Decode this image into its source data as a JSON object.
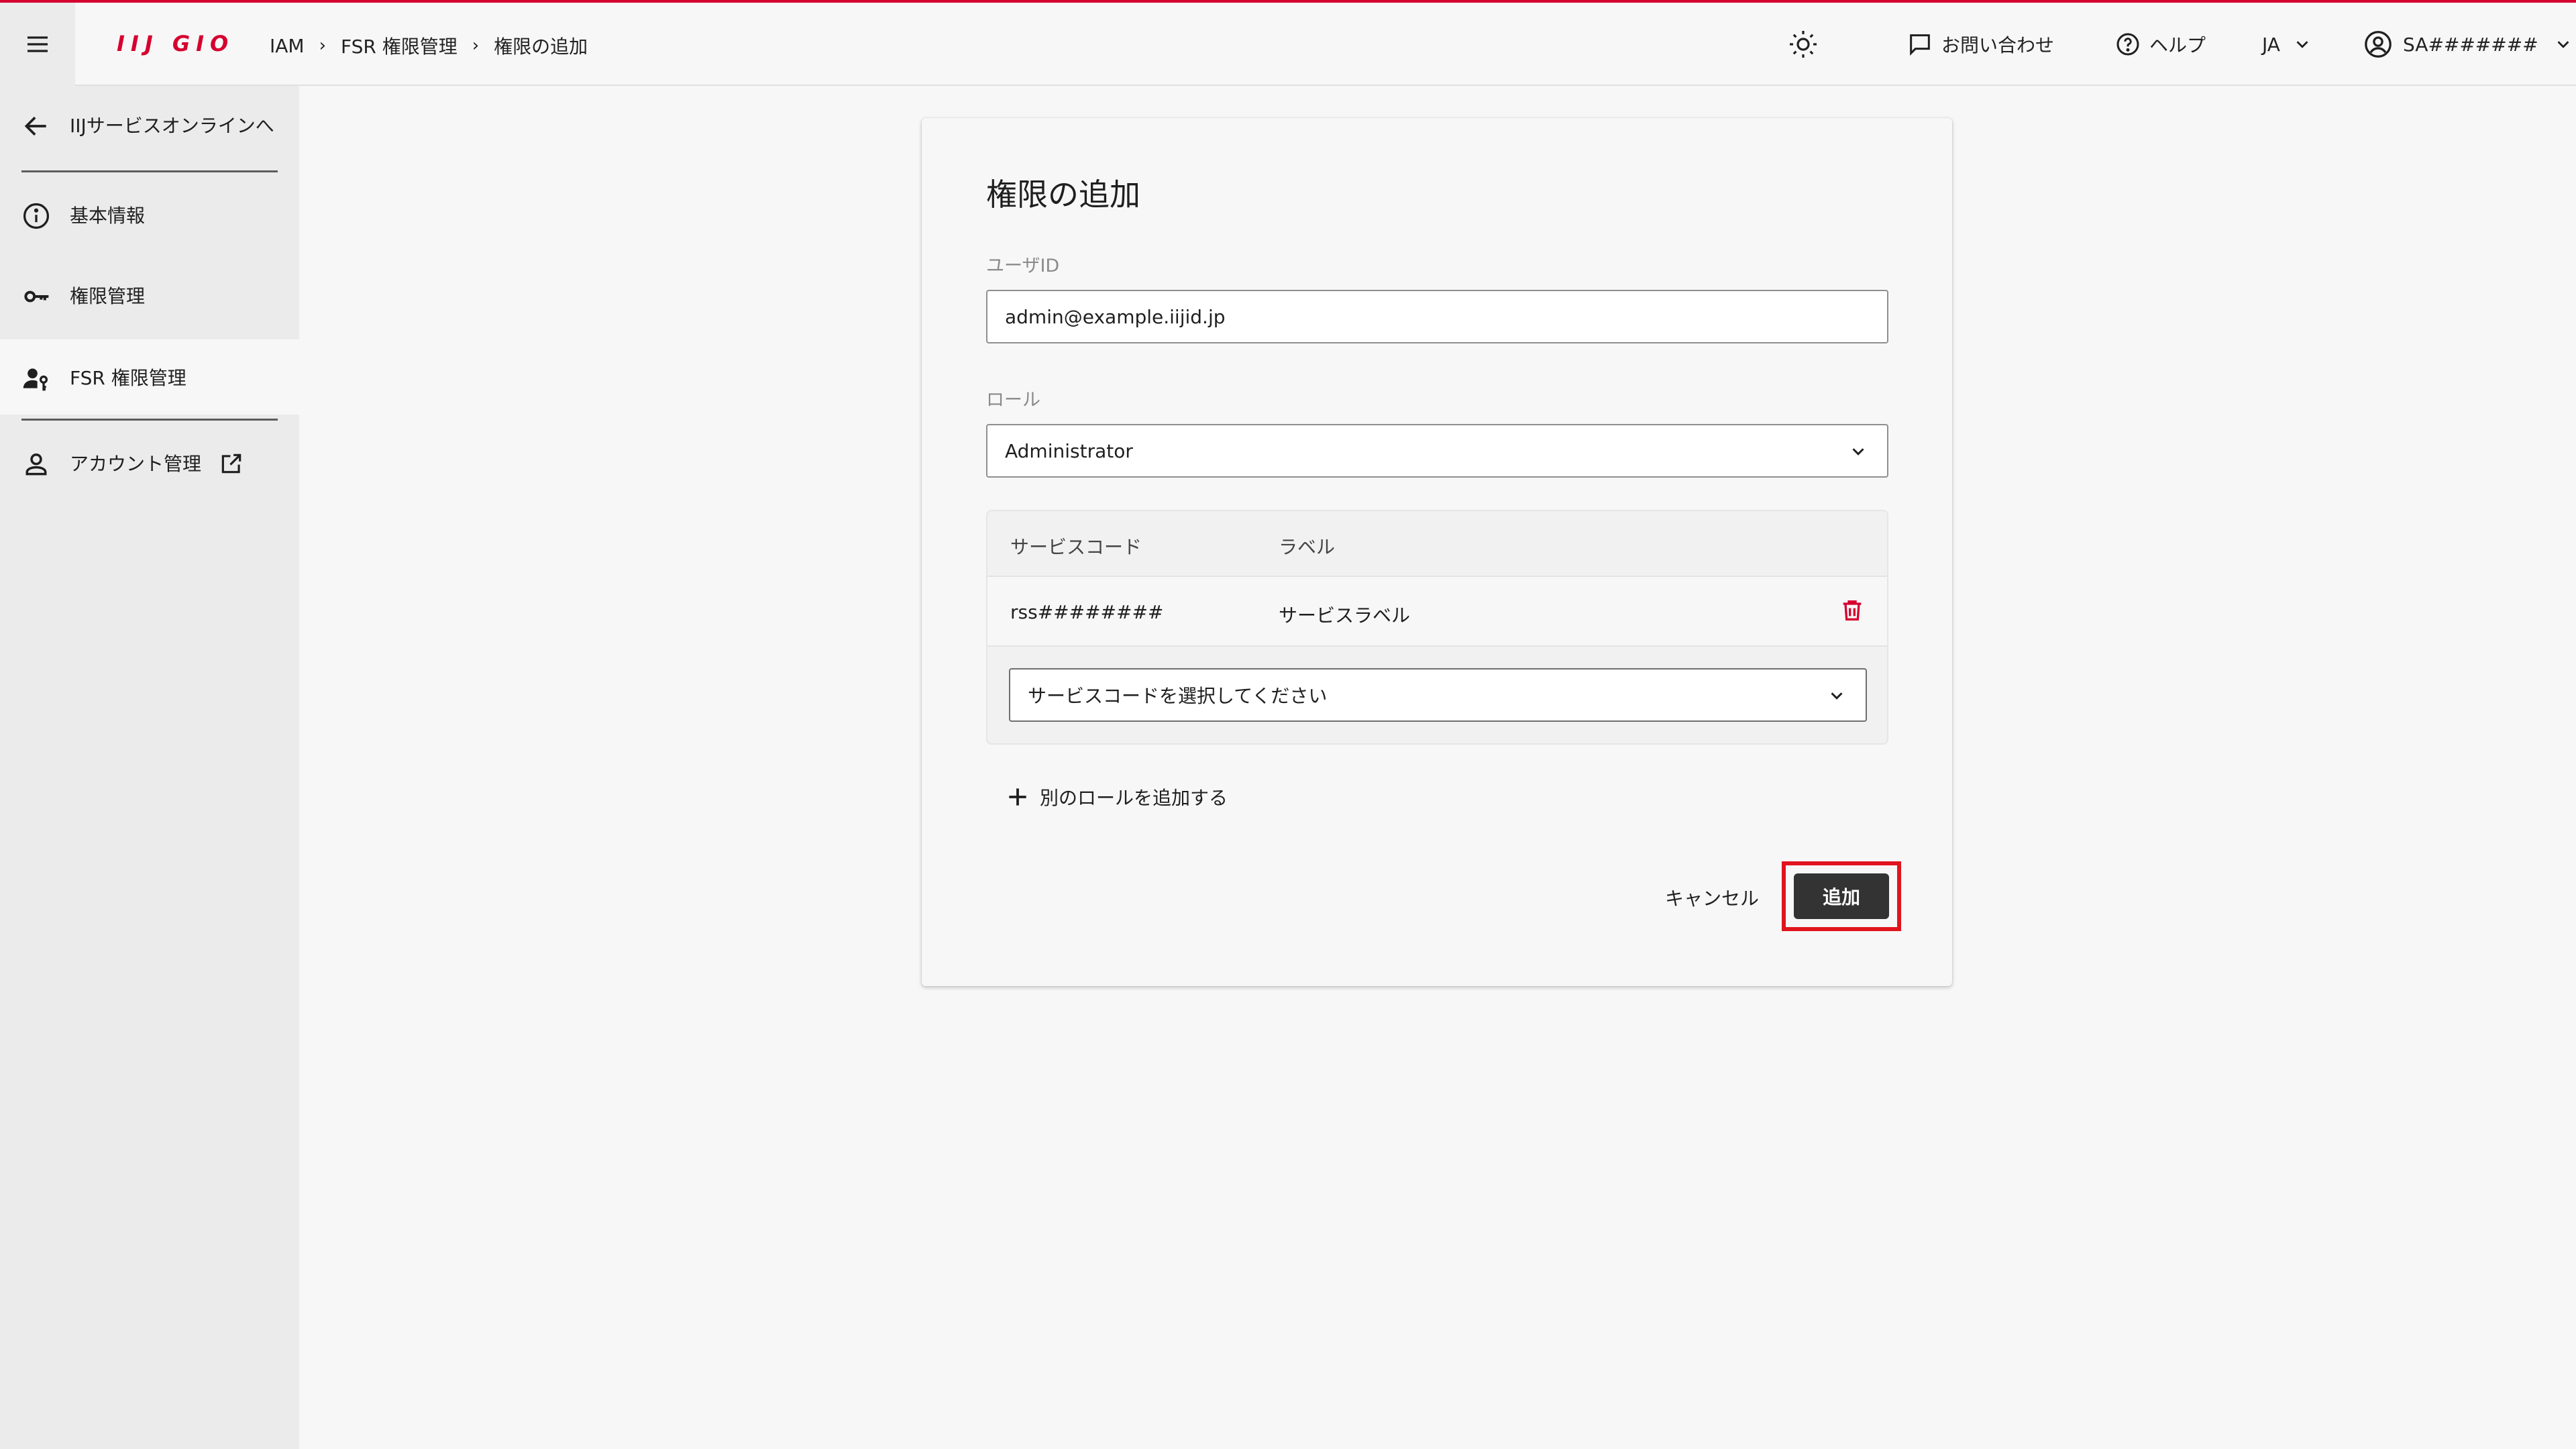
{
  "header": {
    "logo": "IIJ GIO",
    "breadcrumb": [
      "IAM",
      "FSR 権限管理",
      "権限の追加"
    ],
    "breadcrumb_separator": "›",
    "contact_label": "お問い合わせ",
    "help_label": "ヘルプ",
    "language": "JA",
    "account": "SA#######"
  },
  "sidebar": {
    "back_label": "IIJサービスオンラインへ",
    "items": [
      {
        "label": "基本情報",
        "icon": "info-icon"
      },
      {
        "label": "権限管理",
        "icon": "key-icon"
      },
      {
        "label": "FSR 権限管理",
        "icon": "user-key-icon",
        "active": true
      },
      {
        "label": "アカウント管理",
        "icon": "person-icon",
        "external": true
      }
    ]
  },
  "form": {
    "title": "権限の追加",
    "user_id_label": "ユーザID",
    "user_id_value": "admin@example.iijid.jp",
    "role_label": "ロール",
    "role_value": "Administrator",
    "table": {
      "headers": [
        "サービスコード",
        "ラベル"
      ],
      "rows": [
        {
          "service_code": "rss########",
          "label": "サービスラベル"
        }
      ],
      "service_select_placeholder": "サービスコードを選択してください"
    },
    "add_role_label": "別のロールを追加する",
    "cancel_label": "キャンセル",
    "submit_label": "追加"
  },
  "colors": {
    "brand": "#d6002f",
    "highlight": "#e1141e",
    "primary_button": "#333333"
  }
}
